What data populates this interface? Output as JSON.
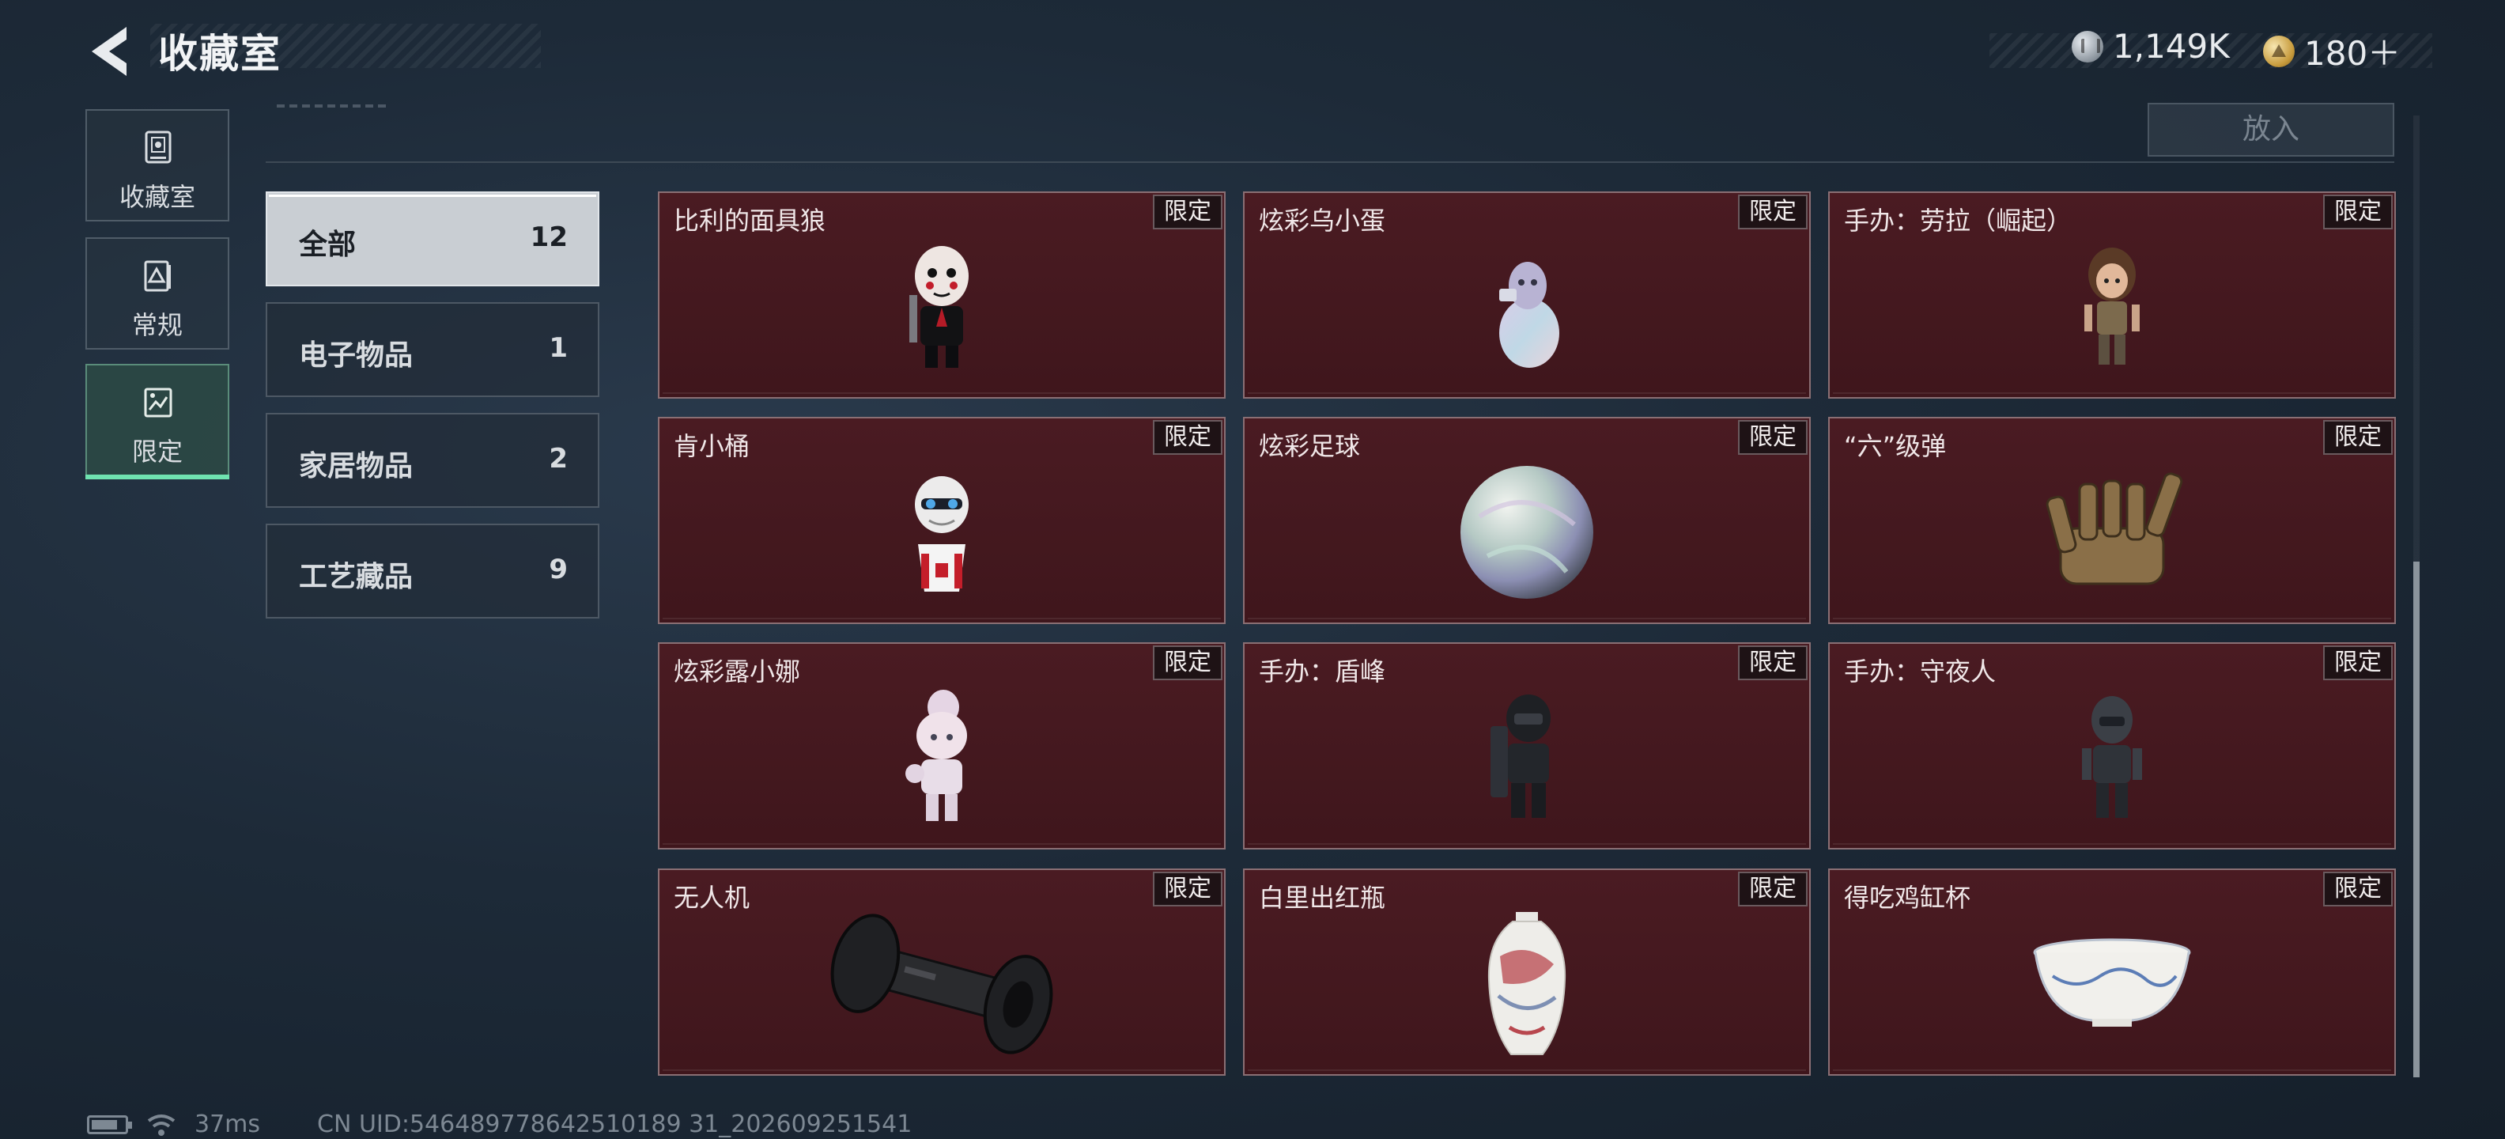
{
  "header": {
    "title": "收藏室"
  },
  "currency": [
    {
      "icon": "silver-coin-icon",
      "value": "1,149K"
    },
    {
      "icon": "gold-coin-icon",
      "value": "180＋"
    }
  ],
  "nav": [
    {
      "label": "收藏室",
      "icon": "collection-icon",
      "active": false
    },
    {
      "label": "常规",
      "icon": "regular-icon",
      "active": false
    },
    {
      "label": "限定",
      "icon": "limited-icon",
      "active": true
    }
  ],
  "place_button": "放入",
  "categories": [
    {
      "label": "全部",
      "count": "12",
      "active": true
    },
    {
      "label": "电子物品",
      "count": "1",
      "active": false
    },
    {
      "label": "家居物品",
      "count": "2",
      "active": false
    },
    {
      "label": "工艺藏品",
      "count": "9",
      "active": false
    }
  ],
  "items": [
    {
      "name": "比利的面具狼",
      "tag": "限定",
      "art": "masked-figure-icon"
    },
    {
      "name": "炫彩乌小蛋",
      "tag": "限定",
      "art": "iridescent-egg-figure-icon"
    },
    {
      "name": "手办：劳拉（崛起）",
      "tag": "限定",
      "art": "lara-figure-icon"
    },
    {
      "name": "肯小桶",
      "tag": "限定",
      "art": "bucket-figure-icon"
    },
    {
      "name": "炫彩足球",
      "tag": "限定",
      "art": "iridescent-ball-icon"
    },
    {
      "name": "“六”级弹",
      "tag": "限定",
      "art": "bullet-hand-icon"
    },
    {
      "name": "炫彩露小娜",
      "tag": "限定",
      "art": "iridescent-girl-figure-icon"
    },
    {
      "name": "手办：盾峰",
      "tag": "限定",
      "art": "shield-soldier-figure-icon"
    },
    {
      "name": "手办：守夜人",
      "tag": "限定",
      "art": "night-watch-figure-icon"
    },
    {
      "name": "无人机",
      "tag": "限定",
      "art": "drone-part-icon"
    },
    {
      "name": "白里出红瓶",
      "tag": "限定",
      "art": "porcelain-vase-icon"
    },
    {
      "name": "得吃鸡缸杯",
      "tag": "限定",
      "art": "porcelain-cup-icon"
    }
  ],
  "status": {
    "ping": "37ms",
    "uid": "CN UID:546489778642510189 31_202609251541"
  }
}
